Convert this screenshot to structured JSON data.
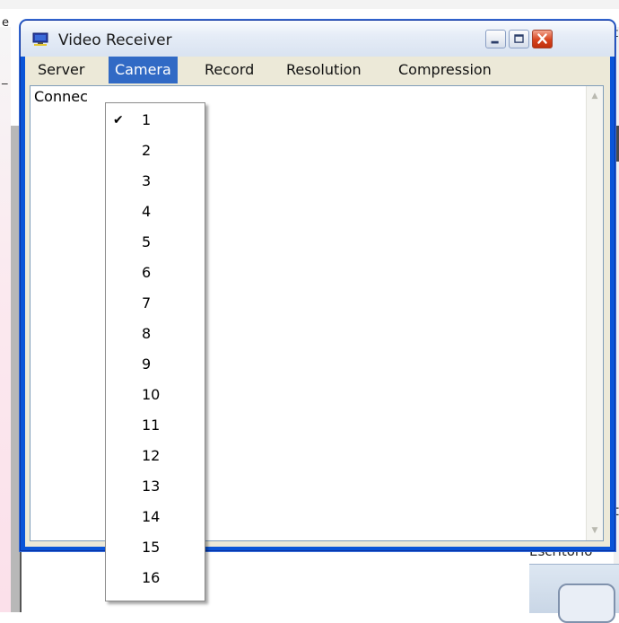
{
  "window": {
    "title": "Video Receiver",
    "icon": "monitor-app-icon",
    "controls": [
      "minimize-icon",
      "maximize-icon",
      "close-icon"
    ]
  },
  "menubar": {
    "items": [
      {
        "label": "Server"
      },
      {
        "label": "Camera",
        "active": true
      },
      {
        "label": "Record"
      },
      {
        "label": "Resolution"
      },
      {
        "label": "Compression"
      }
    ]
  },
  "text_area": {
    "content": "Connec"
  },
  "camera_menu": {
    "checked": "1",
    "check_glyph": "✔",
    "items": [
      "1",
      "2",
      "3",
      "4",
      "5",
      "6",
      "7",
      "8",
      "9",
      "10",
      "11",
      "12",
      "13",
      "14",
      "15",
      "16"
    ]
  },
  "background": {
    "fragment_top_left": "e",
    "fragment_right_1": "t",
    "fragment_right_2": "t",
    "fragment_left_1": "_",
    "escritorio": "Escritorio"
  },
  "colors": {
    "title_active_border": "#0a55d8",
    "menu_highlight": "#316ac5",
    "close_button": "#d6431e"
  }
}
